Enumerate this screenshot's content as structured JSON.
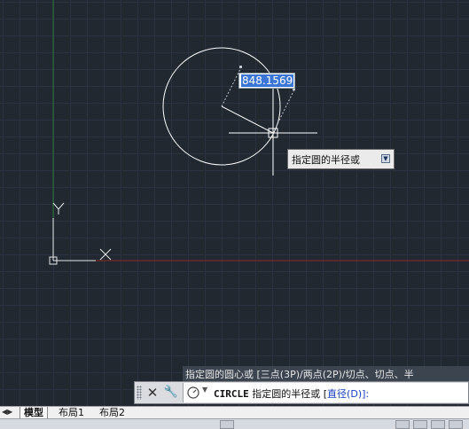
{
  "drawing": {
    "dynamic_input_value": "848.1569",
    "tooltip_text": "指定圆的半径或",
    "ucs_x_label": "X",
    "ucs_y_label": "Y"
  },
  "command": {
    "history_text": "指定圆的圆心或 [三点(3P)/两点(2P)/切点、切点、半",
    "cmd_name": "CIRCLE",
    "prompt_text": " 指定圆的半径或 [",
    "option_prefix": "直径(",
    "option_key": "D",
    "option_suffix": ")]:"
  },
  "tabs": [
    {
      "label": "模型",
      "active": true
    },
    {
      "label": "布局1",
      "active": false
    },
    {
      "label": "布局2",
      "active": false
    }
  ],
  "colors": {
    "background": "#212830",
    "x_axis": "#8a2a2a",
    "y_axis": "#2a7a3a",
    "entities": "#ffffff"
  }
}
